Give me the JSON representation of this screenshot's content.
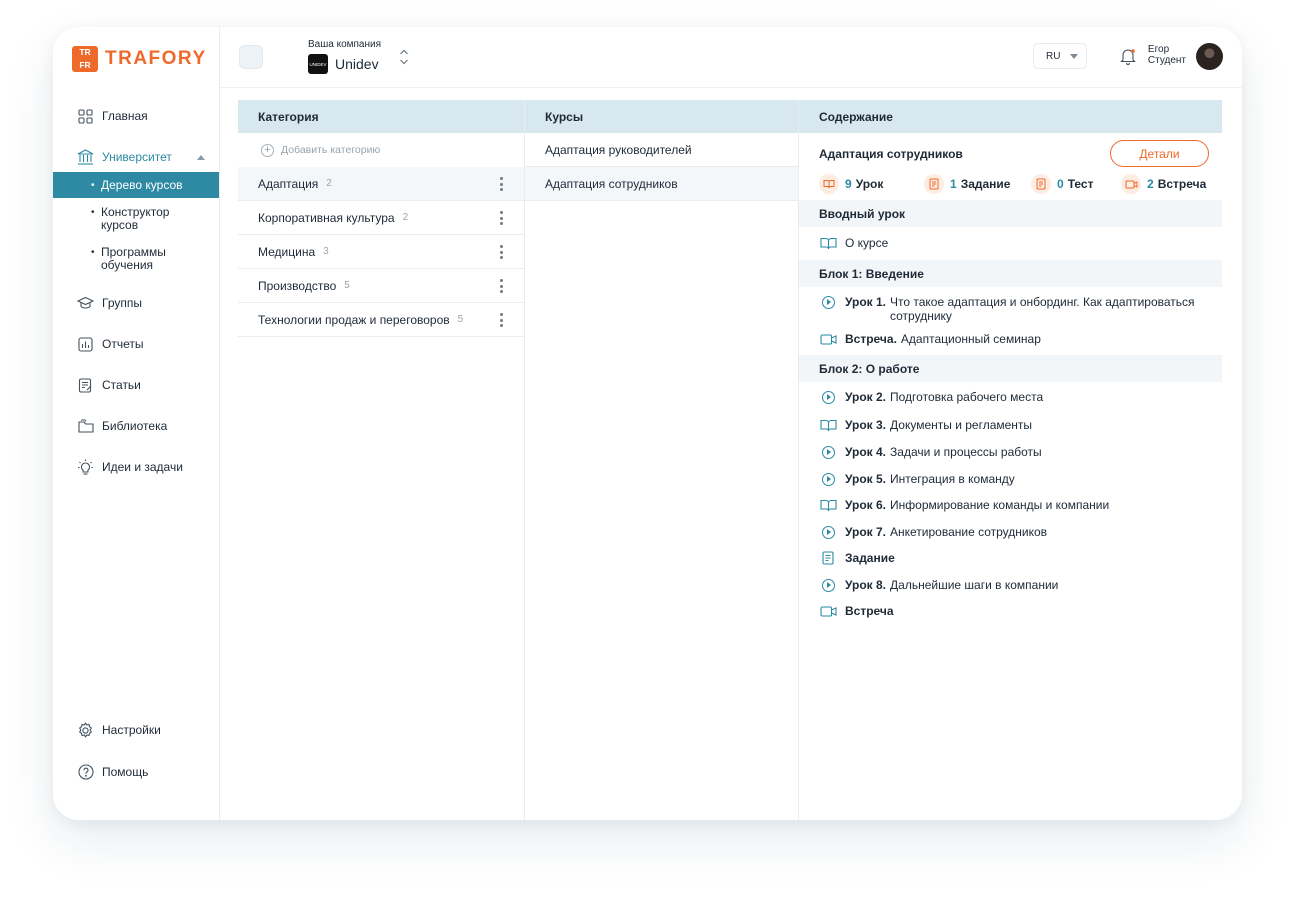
{
  "brand": {
    "logo_letters": [
      "TR",
      "FR"
    ],
    "name": "TRAFORY",
    "accent": "#ee6a2b",
    "teal": "#2b8aa3"
  },
  "sidebar": {
    "main": "Главная",
    "university": "Университет",
    "sub_items": [
      "Дерево курсов",
      "Конструктор курсов",
      "Программы обучения"
    ],
    "groups": "Группы",
    "reports": "Отчеты",
    "articles": "Статьи",
    "library": "Библиотека",
    "ideas": "Идеи и задачи",
    "settings": "Настройки",
    "help": "Помощь"
  },
  "topbar": {
    "company_caption": "Ваша компания",
    "company_logo": "UNIDEV",
    "company_name": "Unidev",
    "lang": "RU",
    "user_name": "Егор",
    "user_role": "Студент"
  },
  "columns": {
    "category": "Категория",
    "courses": "Курсы",
    "content": "Содержание"
  },
  "categories": {
    "add": "Добавить категорию",
    "items": [
      {
        "name": "Адаптация",
        "count": "2"
      },
      {
        "name": "Корпоративная культура",
        "count": "2"
      },
      {
        "name": "Медицина",
        "count": "3"
      },
      {
        "name": "Производство",
        "count": "5"
      },
      {
        "name": "Технологии продаж и переговоров",
        "count": "5"
      }
    ]
  },
  "courses": [
    "Адаптация руководителей",
    "Адаптация сотрудников"
  ],
  "content": {
    "title": "Адаптация сотрудников",
    "details_button": "Детали",
    "stats": [
      {
        "num": "9",
        "label": "Урок",
        "icon": "book-icon"
      },
      {
        "num": "1",
        "label": "Задание",
        "icon": "task-icon"
      },
      {
        "num": "0",
        "label": "Тест",
        "icon": "test-icon"
      },
      {
        "num": "2",
        "label": "Встреча",
        "icon": "video-icon"
      }
    ],
    "intro_block": "Вводный урок",
    "intro_item": "О курсе",
    "block1": "Блок 1: Введение",
    "block1_items": [
      {
        "kind": "Урок 1.",
        "text": "Что такое адаптация и онбординг. Как адаптироваться сотруднику"
      },
      {
        "kind": "Встреча.",
        "text": "Адаптационный семинар"
      }
    ],
    "block2": "Блок 2: О работе",
    "block2_items": [
      {
        "kind": "Урок 2.",
        "text": "Подготовка рабочего места"
      },
      {
        "kind": "Урок 3.",
        "text": "Документы и регламенты"
      },
      {
        "kind": "Урок 4.",
        "text": "Задачи и процессы работы"
      },
      {
        "kind": "Урок 5.",
        "text": "Интеграция в команду"
      },
      {
        "kind": "Урок 6.",
        "text": "Информирование команды и компании"
      },
      {
        "kind": "Урок 7.",
        "text": "Анкетирование сотрудников"
      },
      {
        "kind": "Задание",
        "text": ""
      },
      {
        "kind": "Урок 8.",
        "text": "Дальнейшие шаги в компании"
      },
      {
        "kind": "Встреча",
        "text": ""
      }
    ]
  }
}
